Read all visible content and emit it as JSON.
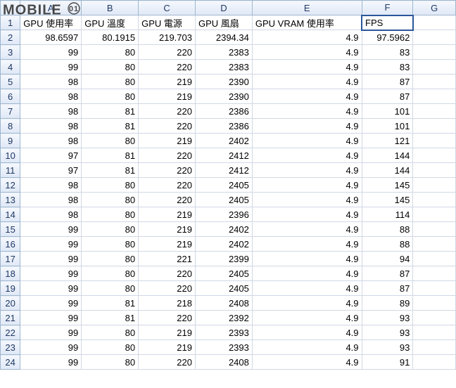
{
  "watermark": "MOBILE",
  "columns": [
    "A",
    "B",
    "C",
    "D",
    "E",
    "F",
    "G"
  ],
  "col_widths": [
    "col-A",
    "col-B",
    "col-C",
    "col-D",
    "col-E",
    "col-F",
    "col-G"
  ],
  "headers": [
    "GPU 使用率",
    "GPU 溫度",
    "GPU 電源",
    "GPU 風扇",
    "GPU VRAM 使用率",
    "FPS",
    ""
  ],
  "selected_cell": {
    "row": 1,
    "col": 5
  },
  "rows": [
    [
      "98.6597",
      "80.1915",
      "219.703",
      "2394.34",
      "4.9",
      "97.5962",
      ""
    ],
    [
      "99",
      "80",
      "220",
      "2383",
      "4.9",
      "83",
      ""
    ],
    [
      "99",
      "80",
      "220",
      "2383",
      "4.9",
      "83",
      ""
    ],
    [
      "98",
      "80",
      "219",
      "2390",
      "4.9",
      "87",
      ""
    ],
    [
      "98",
      "80",
      "219",
      "2390",
      "4.9",
      "87",
      ""
    ],
    [
      "98",
      "81",
      "220",
      "2386",
      "4.9",
      "101",
      ""
    ],
    [
      "98",
      "81",
      "220",
      "2386",
      "4.9",
      "101",
      ""
    ],
    [
      "98",
      "80",
      "219",
      "2402",
      "4.9",
      "121",
      ""
    ],
    [
      "97",
      "81",
      "220",
      "2412",
      "4.9",
      "144",
      ""
    ],
    [
      "97",
      "81",
      "220",
      "2412",
      "4.9",
      "144",
      ""
    ],
    [
      "98",
      "80",
      "220",
      "2405",
      "4.9",
      "145",
      ""
    ],
    [
      "98",
      "80",
      "220",
      "2405",
      "4.9",
      "145",
      ""
    ],
    [
      "98",
      "80",
      "219",
      "2396",
      "4.9",
      "114",
      ""
    ],
    [
      "99",
      "80",
      "219",
      "2402",
      "4.9",
      "88",
      ""
    ],
    [
      "99",
      "80",
      "219",
      "2402",
      "4.9",
      "88",
      ""
    ],
    [
      "99",
      "80",
      "221",
      "2399",
      "4.9",
      "94",
      ""
    ],
    [
      "99",
      "80",
      "220",
      "2405",
      "4.9",
      "87",
      ""
    ],
    [
      "99",
      "80",
      "220",
      "2405",
      "4.9",
      "87",
      ""
    ],
    [
      "99",
      "81",
      "218",
      "2408",
      "4.9",
      "89",
      ""
    ],
    [
      "99",
      "81",
      "220",
      "2392",
      "4.9",
      "93",
      ""
    ],
    [
      "99",
      "80",
      "219",
      "2393",
      "4.9",
      "93",
      ""
    ],
    [
      "99",
      "80",
      "219",
      "2393",
      "4.9",
      "93",
      ""
    ],
    [
      "99",
      "80",
      "220",
      "2408",
      "4.9",
      "91",
      ""
    ]
  ],
  "chart_data": {
    "type": "table",
    "columns": [
      "GPU 使用率",
      "GPU 溫度",
      "GPU 電源",
      "GPU 風扇",
      "GPU VRAM 使用率",
      "FPS"
    ],
    "data": [
      [
        98.6597,
        80.1915,
        219.703,
        2394.34,
        4.9,
        97.5962
      ],
      [
        99,
        80,
        220,
        2383,
        4.9,
        83
      ],
      [
        99,
        80,
        220,
        2383,
        4.9,
        83
      ],
      [
        98,
        80,
        219,
        2390,
        4.9,
        87
      ],
      [
        98,
        80,
        219,
        2390,
        4.9,
        87
      ],
      [
        98,
        81,
        220,
        2386,
        4.9,
        101
      ],
      [
        98,
        81,
        220,
        2386,
        4.9,
        101
      ],
      [
        98,
        80,
        219,
        2402,
        4.9,
        121
      ],
      [
        97,
        81,
        220,
        2412,
        4.9,
        144
      ],
      [
        97,
        81,
        220,
        2412,
        4.9,
        144
      ],
      [
        98,
        80,
        220,
        2405,
        4.9,
        145
      ],
      [
        98,
        80,
        220,
        2405,
        4.9,
        145
      ],
      [
        98,
        80,
        219,
        2396,
        4.9,
        114
      ],
      [
        99,
        80,
        219,
        2402,
        4.9,
        88
      ],
      [
        99,
        80,
        219,
        2402,
        4.9,
        88
      ],
      [
        99,
        80,
        221,
        2399,
        4.9,
        94
      ],
      [
        99,
        80,
        220,
        2405,
        4.9,
        87
      ],
      [
        99,
        80,
        220,
        2405,
        4.9,
        87
      ],
      [
        99,
        81,
        218,
        2408,
        4.9,
        89
      ],
      [
        99,
        81,
        220,
        2392,
        4.9,
        93
      ],
      [
        99,
        80,
        219,
        2393,
        4.9,
        93
      ],
      [
        99,
        80,
        219,
        2393,
        4.9,
        93
      ],
      [
        99,
        80,
        220,
        2408,
        4.9,
        91
      ]
    ]
  }
}
